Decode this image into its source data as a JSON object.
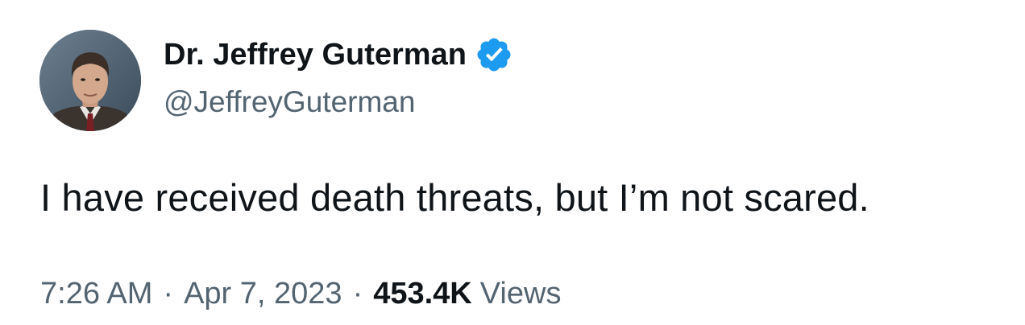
{
  "author": {
    "display_name": "Dr. Jeffrey Guterman",
    "handle": "@JeffreyGuterman",
    "verified": true,
    "avatar_icon": "profile-photo"
  },
  "tweet": {
    "text": "I have received death threats, but I’m not scared.",
    "time": "7:26 AM",
    "separator": "·",
    "date": "Apr 7, 2023",
    "views_count": "453.4K",
    "views_label": "Views"
  },
  "colors": {
    "primary_text": "#0f1419",
    "secondary_text": "#536471",
    "verified_badge": "#1d9bf0",
    "background": "#ffffff"
  }
}
